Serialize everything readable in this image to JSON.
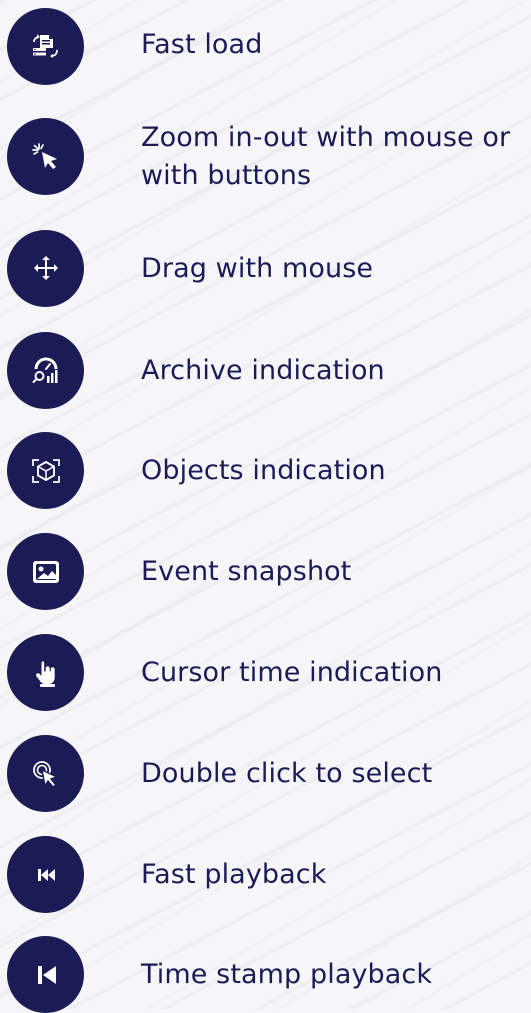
{
  "colors": {
    "icon_background": "#1b1b55",
    "label_text": "#1c1b57",
    "page_background": "#f6f6f8"
  },
  "features": [
    {
      "icon": "fast-load-icon",
      "label": "Fast load"
    },
    {
      "icon": "zoom-cursor-icon",
      "label": "Zoom in-out with mouse or with buttons"
    },
    {
      "icon": "drag-move-icon",
      "label": "Drag with mouse"
    },
    {
      "icon": "archive-indication-icon",
      "label": "Archive indication"
    },
    {
      "icon": "objects-indication-icon",
      "label": "Objects indication"
    },
    {
      "icon": "event-snapshot-icon",
      "label": "Event snapshot"
    },
    {
      "icon": "cursor-time-icon",
      "label": "Cursor time indication"
    },
    {
      "icon": "double-click-icon",
      "label": "Double click to select"
    },
    {
      "icon": "fast-playback-icon",
      "label": "Fast playback"
    },
    {
      "icon": "time-stamp-playback-icon",
      "label": "Time stamp playback"
    }
  ]
}
